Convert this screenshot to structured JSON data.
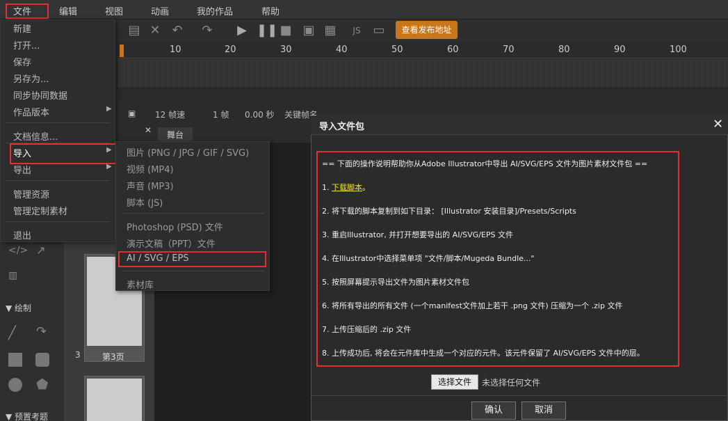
{
  "menubar": {
    "items": [
      "文件",
      "编辑",
      "视图",
      "动画",
      "我的作品",
      "帮助"
    ]
  },
  "toolbar": {
    "publish_label": "查看发布地址"
  },
  "timeline": {
    "ruler": [
      "10",
      "20",
      "30",
      "40",
      "50",
      "60",
      "70",
      "80",
      "90",
      "100"
    ],
    "status": {
      "fps": "12 帧速",
      "frame": "1 帧",
      "seconds": "0.00 秒",
      "keyframe": "关键帧名"
    }
  },
  "stage": {
    "tab_label": "舞台"
  },
  "file_menu": {
    "items": [
      "新建",
      "打开...",
      "保存",
      "另存为...",
      "同步协同数据",
      "作品版本",
      "文档信息...",
      "导入",
      "导出",
      "管理资源",
      "管理定制素材",
      "退出"
    ]
  },
  "import_submenu": {
    "items": [
      "图片 (PNG / JPG / GIF / SVG)",
      "视频 (MP4)",
      "声音 (MP3)",
      "脚本 (JS)",
      "Photoshop (PSD) 文件",
      "演示文稿（PPT）文件",
      "AI / SVG / EPS",
      "素材库"
    ]
  },
  "left_panel": {
    "draw_label": "绘制",
    "preset_label": "预置考题"
  },
  "thumbnails": {
    "page_number": "3",
    "page_label": "第3页"
  },
  "dialog": {
    "title": "导入文件包",
    "close_symbol": "✕",
    "intro": "== 下面的操作说明帮助你从Adobe Illustrator中导出 AI/SVG/EPS 文件为图片素材文件包 ==",
    "step1_prefix": "1. ",
    "step1_link": "下载脚本",
    "step1_suffix": "。",
    "step2": "2. 将下载的脚本复制到如下目录： [Illustrator 安装目录]/Presets/Scripts",
    "step3": "3. 重启Illustrator, 并打开想要导出的 AI/SVG/EPS 文件",
    "step4": "4. 在Illustrator中选择菜单项 \"文件/脚本/Mugeda Bundle...\"",
    "step5": "5. 按照屏幕提示导出文件为图片素材文件包",
    "step6": "6. 将所有导出的所有文件 (一个manifest文件加上若干 .png 文件) 压缩为一个 .zip 文件",
    "step7": "7. 上传压缩后的 .zip 文件",
    "step8": "8. 上传成功后, 将会在元件库中生成一个对应的元件。该元件保留了 AI/SVG/EPS 文件中的层。",
    "choose_file_label": "选择文件",
    "no_file_text": "未选择任何文件",
    "ok_label": "确认",
    "cancel_label": "取消"
  }
}
